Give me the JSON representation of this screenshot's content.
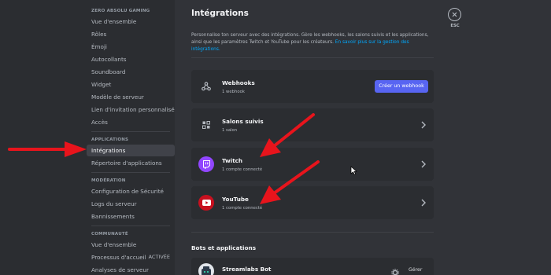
{
  "sidebar": {
    "server_name": "ZERO ABSOLU GAMING",
    "items_top": [
      {
        "label": "Vue d'ensemble"
      },
      {
        "label": "Rôles"
      },
      {
        "label": "Émoji"
      },
      {
        "label": "Autocollants"
      },
      {
        "label": "Soundboard"
      },
      {
        "label": "Widget"
      },
      {
        "label": "Modèle de serveur"
      },
      {
        "label": "Lien d'invitation personnalisé"
      },
      {
        "label": "Accès"
      }
    ],
    "apps_header": "APPLICATIONS",
    "apps_items": [
      {
        "label": "Intégrations"
      },
      {
        "label": "Répertoire d'applications"
      }
    ],
    "moderation_header": "MODÉRATION",
    "moderation_items": [
      {
        "label": "Configuration de Sécurité"
      },
      {
        "label": "Logs du serveur"
      },
      {
        "label": "Bannissements"
      }
    ],
    "community_header": "COMMUNAUTÉ",
    "community_items": [
      {
        "label": "Vue d'ensemble"
      },
      {
        "label": "Processus d'accueil",
        "badge": "ACTIVÉE"
      },
      {
        "label": "Analyses de serveur"
      }
    ]
  },
  "main": {
    "title": "Intégrations",
    "description": "Personnalise ton serveur avec des intégrations. Gère les webhooks, les salons suivis et les applications, ainsi que les paramètres Twitch et YouTube pour les créateurs.",
    "description_link": "En savoir plus sur la gestion des intégrations.",
    "cards": {
      "webhooks": {
        "title": "Webhooks",
        "subtitle": "1 webhook",
        "button": "Créer un webhook"
      },
      "followed": {
        "title": "Salons suivis",
        "subtitle": "1 salon"
      },
      "twitch": {
        "title": "Twitch",
        "subtitle": "1 compte connecté"
      },
      "youtube": {
        "title": "YouTube",
        "subtitle": "1 compte connecté"
      }
    },
    "bots_header": "Bots et applications",
    "bot": {
      "name": "Streamlabs Bot",
      "manage": "Gérer"
    }
  },
  "close": {
    "label": "ESC"
  },
  "colors": {
    "accent": "#5865f2",
    "twitch": "#9146ff",
    "youtube": "#c8101f",
    "annotation_arrow": "#e8141c"
  },
  "icons": [
    "webhook-icon",
    "followed-channel-icon",
    "twitch-icon",
    "youtube-icon",
    "chevron-right-icon",
    "close-icon",
    "gear-icon",
    "mouse-cursor-icon",
    "annotation-arrow"
  ]
}
